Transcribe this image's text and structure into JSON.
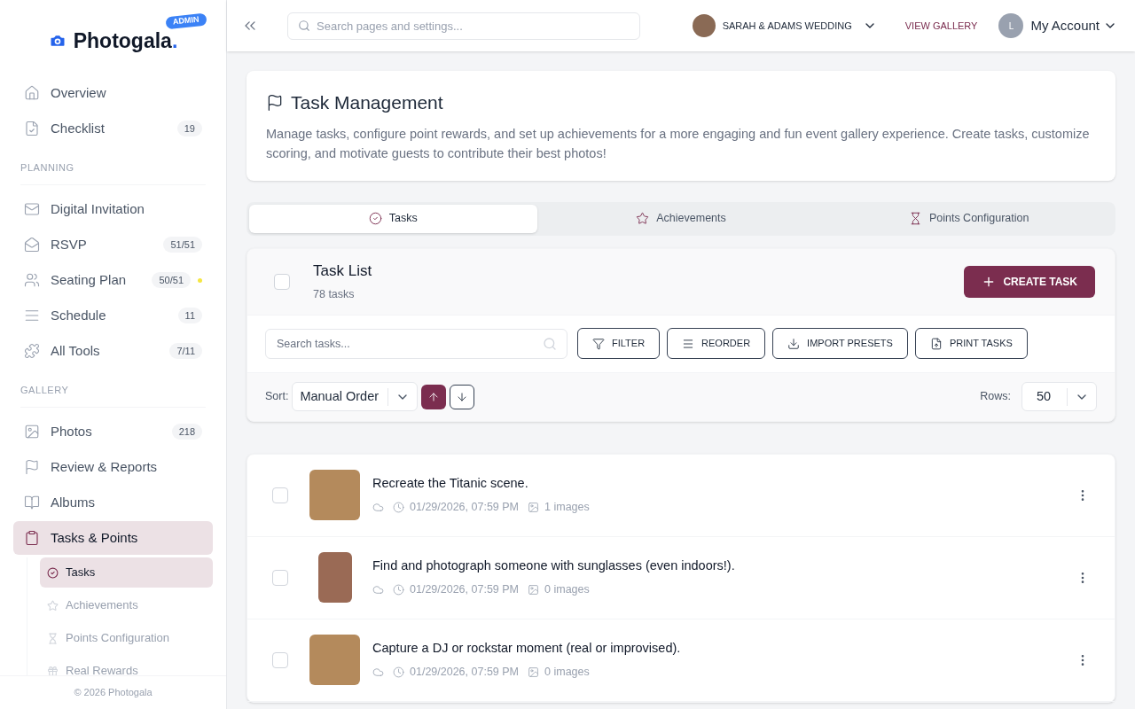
{
  "brand": {
    "name": "Photogala",
    "suffix": ".",
    "badge": "ADMIN"
  },
  "sidebar": {
    "sections": [
      {
        "items": [
          {
            "label": "Overview",
            "selected": false
          },
          {
            "label": "Checklist",
            "badge": "19",
            "selected": false
          }
        ]
      },
      {
        "heading": "PLANNING",
        "items": [
          {
            "label": "Digital Invitation",
            "selected": false
          },
          {
            "label": "RSVP",
            "badge": "51/51",
            "selected": false
          },
          {
            "label": "Seating Plan",
            "badge": "50/51",
            "color": "#f5e642",
            "selected": false
          },
          {
            "label": "Schedule",
            "badge": "11",
            "selected": false
          },
          {
            "label": "All Tools",
            "badge": "7/11",
            "selected": false
          }
        ]
      },
      {
        "heading": "GALLERY",
        "items": [
          {
            "label": "Photos",
            "badge": "218",
            "selected": false
          },
          {
            "label": "Review & Reports",
            "selected": false
          },
          {
            "label": "Albums",
            "selected": false
          },
          {
            "label": "Tasks & Points",
            "selected": true,
            "children": [
              {
                "label": "Tasks",
                "selected": true
              },
              {
                "label": "Achievements",
                "selected": false
              },
              {
                "label": "Points Configuration",
                "selected": false
              },
              {
                "label": "Real Rewards",
                "selected": false
              }
            ]
          }
        ]
      }
    ],
    "footer": "© 2026 Photogala"
  },
  "topbar": {
    "search_placeholder": "Search pages and settings...",
    "event": "SARAH & ADAMS WEDDING",
    "view_gallery": "VIEW GALLERY",
    "account_initial": "L",
    "account": "My Account"
  },
  "page_header": {
    "title": "Task Management",
    "description": "Manage tasks, configure point rewards, and set up achievements for a more engaging and fun event gallery experience. Create tasks, customize scoring, and motivate guests to contribute their best photos!"
  },
  "tabs": [
    {
      "label": "Tasks",
      "selected": true
    },
    {
      "label": "Achievements",
      "selected": false
    },
    {
      "label": "Points Configuration",
      "selected": false
    }
  ],
  "task_list": {
    "title": "Task List",
    "count": "78 tasks",
    "select_all": false,
    "create_button": "CREATE TASK",
    "search_placeholder": "Search tasks...",
    "actions": [
      "FILTER",
      "REORDER",
      "IMPORT PRESETS",
      "PRINT TASKS"
    ],
    "sort_label": "Sort:",
    "sort_value": "Manual Order",
    "sort_directions": [
      {
        "selected": true
      },
      {
        "selected": false
      }
    ],
    "rows_label": "Rows:",
    "rows_value": "50"
  },
  "tasks": [
    {
      "title": "Recreate the Titanic scene.",
      "date": "01/29/2026, 07:59 PM",
      "images": "1 images",
      "checked": false
    },
    {
      "title": "Find and photograph someone with sunglasses (even indoors!).",
      "date": "01/29/2026, 07:59 PM",
      "images": "0 images",
      "checked": false
    },
    {
      "title": "Capture a DJ or rockstar moment (real or improvised).",
      "date": "01/29/2026, 07:59 PM",
      "images": "0 images",
      "checked": false
    }
  ]
}
